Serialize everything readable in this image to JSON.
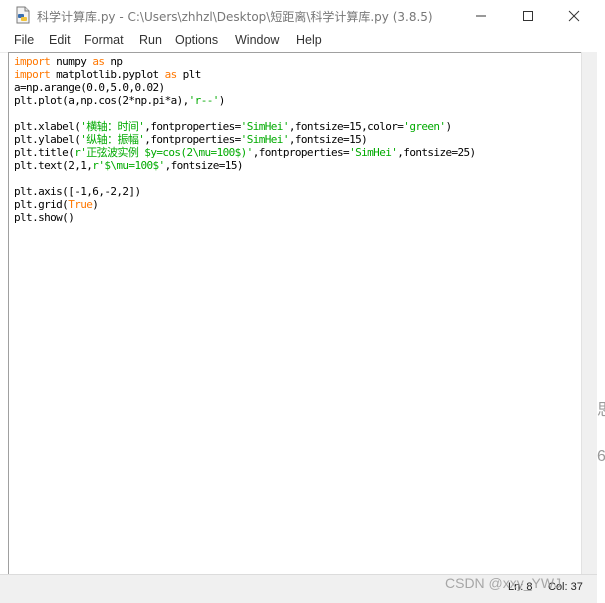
{
  "window": {
    "title": "科学计算库.py - C:\\Users\\zhhzl\\Desktop\\短距离\\科学计算库.py (3.8.5)",
    "controls": {
      "minimize": "—",
      "maximize": "☐",
      "close": "✕"
    }
  },
  "menu": [
    "File",
    "Edit",
    "Format",
    "Run",
    "Options",
    "Window",
    "Help"
  ],
  "code": [
    [
      {
        "t": "import",
        "c": "kw"
      },
      {
        "t": " numpy ",
        "c": "plain"
      },
      {
        "t": "as",
        "c": "kw"
      },
      {
        "t": " np",
        "c": "plain"
      }
    ],
    [
      {
        "t": "import",
        "c": "kw"
      },
      {
        "t": " matplotlib.pyplot ",
        "c": "plain"
      },
      {
        "t": "as",
        "c": "kw"
      },
      {
        "t": " plt",
        "c": "plain"
      }
    ],
    [
      {
        "t": "a=np.arange(0.0,5.0,0.02)",
        "c": "plain"
      }
    ],
    [
      {
        "t": "plt.plot(a,np.cos(2*np.pi*a),",
        "c": "plain"
      },
      {
        "t": "'r--'",
        "c": "str"
      },
      {
        "t": ")",
        "c": "plain"
      }
    ],
    [],
    [
      {
        "t": "plt.xlabel(",
        "c": "plain"
      },
      {
        "t": "'横轴：时间'",
        "c": "str"
      },
      {
        "t": ",fontproperties=",
        "c": "plain"
      },
      {
        "t": "'SimHei'",
        "c": "str"
      },
      {
        "t": ",fontsize=15,color=",
        "c": "plain"
      },
      {
        "t": "'green'",
        "c": "str"
      },
      {
        "t": ")",
        "c": "plain"
      }
    ],
    [
      {
        "t": "plt.ylabel(",
        "c": "plain"
      },
      {
        "t": "'纵轴：振幅'",
        "c": "str"
      },
      {
        "t": ",fontproperties=",
        "c": "plain"
      },
      {
        "t": "'SimHei'",
        "c": "str"
      },
      {
        "t": ",fontsize=15)",
        "c": "plain"
      }
    ],
    [
      {
        "t": "plt.title(",
        "c": "plain"
      },
      {
        "t": "r'正弦波实例 $y=cos(2\\mu=100$)'",
        "c": "str"
      },
      {
        "t": ",fontproperties=",
        "c": "plain"
      },
      {
        "t": "'SimHei'",
        "c": "str"
      },
      {
        "t": ",fontsize=25)",
        "c": "plain"
      }
    ],
    [
      {
        "t": "plt.text(2,1,",
        "c": "plain"
      },
      {
        "t": "r'$\\mu=100$'",
        "c": "str"
      },
      {
        "t": ",fontsize=15)",
        "c": "plain"
      }
    ],
    [],
    [
      {
        "t": "plt.axis([-1,6,-2,2])",
        "c": "plain"
      }
    ],
    [
      {
        "t": "plt.grid(",
        "c": "plain"
      },
      {
        "t": "True",
        "c": "kw"
      },
      {
        "t": ")",
        "c": "plain"
      }
    ],
    [
      {
        "t": "plt.show()",
        "c": "plain"
      }
    ]
  ],
  "status": {
    "line": "Ln: 8",
    "col": "Col: 37"
  },
  "watermark": "CSDN @xxy_YWJ",
  "side_glyphs": [
    "思",
    "6"
  ],
  "colors": {
    "keyword": "#ff7700",
    "string": "#00aa00",
    "text": "#000000"
  }
}
